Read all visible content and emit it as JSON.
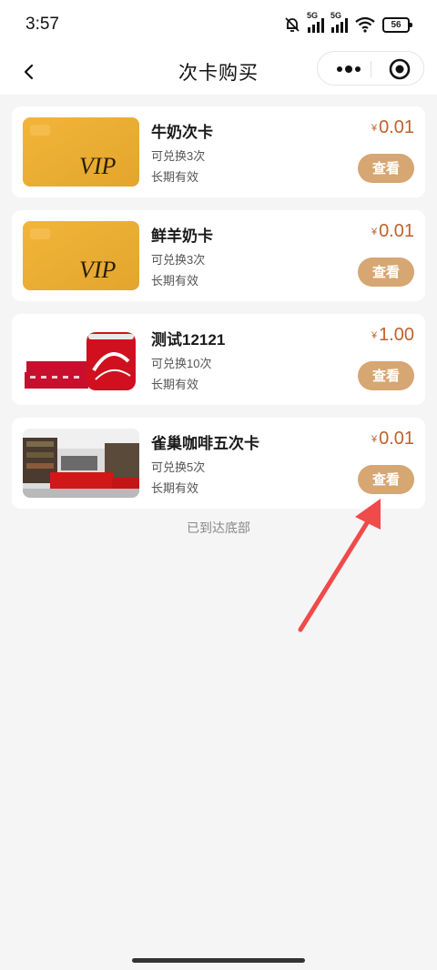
{
  "status_bar": {
    "time": "3:57",
    "network_tag": "5G",
    "battery": "56"
  },
  "nav": {
    "title": "次卡购买"
  },
  "cards": [
    {
      "title": "牛奶次卡",
      "redeem": "可兑换3次",
      "validity": "长期有效",
      "currency": "¥",
      "price": "0.01",
      "button": "查看",
      "image": "vip-card",
      "vip_text": "VIP"
    },
    {
      "title": "鲜羊奶卡",
      "redeem": "可兑换3次",
      "validity": "长期有效",
      "currency": "¥",
      "price": "0.01",
      "button": "查看",
      "image": "vip-card",
      "vip_text": "VIP"
    },
    {
      "title": "测试12121",
      "redeem": "可兑换10次",
      "validity": "长期有效",
      "currency": "¥",
      "price": "1.00",
      "button": "查看",
      "image": "cola-cans"
    },
    {
      "title": "雀巢咖啡五次卡",
      "redeem": "可兑换5次",
      "validity": "长期有效",
      "currency": "¥",
      "price": "0.01",
      "button": "查看",
      "image": "store-interior"
    }
  ],
  "footer_text": "已到达底部",
  "colors": {
    "price": "#c0612b",
    "button": "#d6a673",
    "annotation_arrow": "#f04a4a"
  }
}
